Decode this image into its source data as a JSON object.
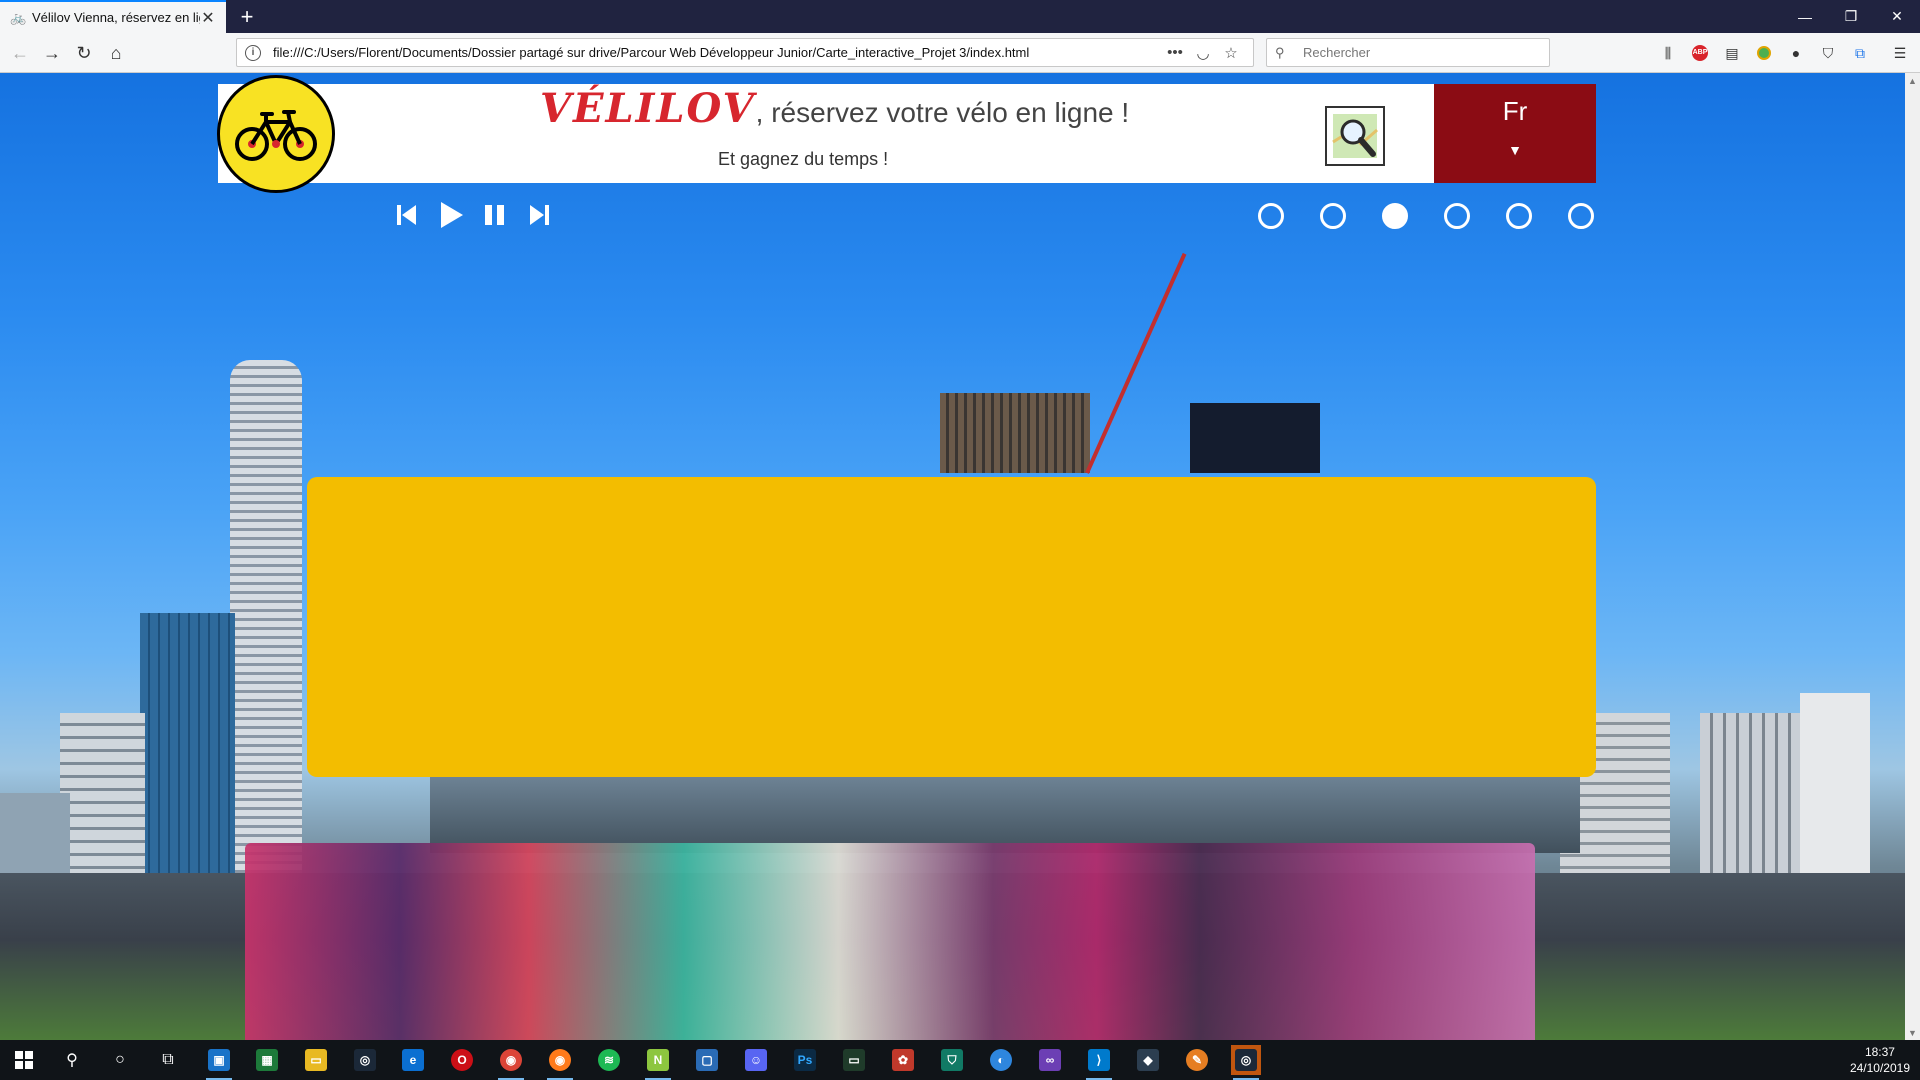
{
  "browser": {
    "tab_title": "Vélilov Vienna, réservez en ligne",
    "url": "file:///C:/Users/Florent/Documents/Dossier partagé sur drive/Parcour Web Développeur Junior/Carte_interactive_Projet 3/index.html",
    "search_placeholder": "Rechercher"
  },
  "header": {
    "brand_name": "VÉLILOV",
    "brand_tagline": ", réservez votre vélo en ligne !",
    "subtitle": "Et gagnez du temps !",
    "language": "Fr"
  },
  "slider": {
    "slide_count": 6,
    "active_index": 2
  },
  "colors": {
    "brand_red": "#d7262e",
    "lang_bg": "#8b0c14",
    "panel_yellow": "#f3bd00",
    "logo_yellow": "#f8e223"
  },
  "taskbar": {
    "time": "18:37",
    "date": "24/10/2019"
  }
}
